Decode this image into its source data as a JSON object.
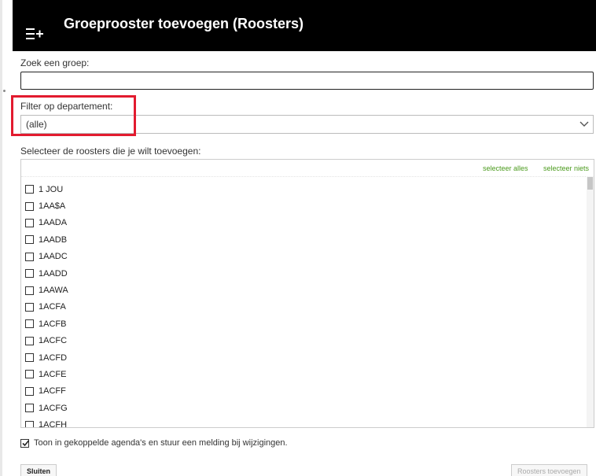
{
  "header": {
    "icon": "add-list-icon",
    "title": "Groeprooster toevoegen (Roosters)"
  },
  "search": {
    "label": "Zoek een groep:",
    "value": "",
    "placeholder": ""
  },
  "filter": {
    "label": "Filter op departement:",
    "selected": "(alle)",
    "highlight_color": "#e21b2f"
  },
  "list": {
    "label": "Selecteer de roosters die je wilt toevoegen:",
    "select_all": "selecteer alles",
    "select_none": "selecteer niets",
    "link_color": "#4a9a1c",
    "items": [
      {
        "label": "1 JOU",
        "checked": false
      },
      {
        "label": "1AA$A",
        "checked": false
      },
      {
        "label": "1AADA",
        "checked": false
      },
      {
        "label": "1AADB",
        "checked": false
      },
      {
        "label": "1AADC",
        "checked": false
      },
      {
        "label": "1AADD",
        "checked": false
      },
      {
        "label": "1AAWA",
        "checked": false
      },
      {
        "label": "1ACFA",
        "checked": false
      },
      {
        "label": "1ACFB",
        "checked": false
      },
      {
        "label": "1ACFC",
        "checked": false
      },
      {
        "label": "1ACFD",
        "checked": false
      },
      {
        "label": "1ACFE",
        "checked": false
      },
      {
        "label": "1ACFF",
        "checked": false
      },
      {
        "label": "1ACFG",
        "checked": false
      },
      {
        "label": "1ACFH",
        "checked": false
      }
    ]
  },
  "sync_option": {
    "label": "Toon in gekoppelde agenda's en stuur een melding bij wijzigingen.",
    "checked": true
  },
  "buttons": {
    "close": "Sluiten",
    "add": "Roosters toevoegen",
    "add_enabled": false
  }
}
